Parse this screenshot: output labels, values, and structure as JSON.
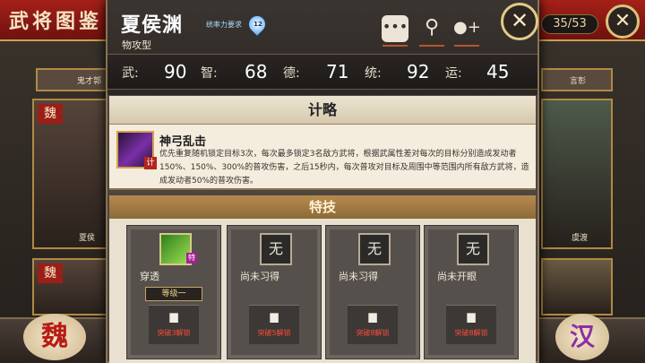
{
  "background": {
    "title": "武将图鉴",
    "count": "35/53",
    "left_card_name_top": "鬼才郭",
    "left_card_name": "夏侯",
    "left_faction": "魏",
    "right_card_name_top": "言彰",
    "right_card_name": "虞渡",
    "bottom_left_faction": "魏",
    "bottom_right_faction": "汉"
  },
  "general": {
    "name": "夏侯渊",
    "type": "物攻型",
    "badge": "统率力要求",
    "badge_level": "12",
    "stats": [
      {
        "key": "武:",
        "value": "90"
      },
      {
        "key": "智:",
        "value": "68"
      },
      {
        "key": "德:",
        "value": "71"
      },
      {
        "key": "统:",
        "value": "92"
      },
      {
        "key": "运:",
        "value": "45"
      }
    ]
  },
  "toolbar": {
    "chat_icon": "chat-bubble-icon",
    "search_icon": "magnifier-icon",
    "add_icon": "treasure-add-icon",
    "close_icon": "crossed-swords-close-icon"
  },
  "strategy": {
    "title": "计略",
    "name": "神弓乱击",
    "icon_tag": "计",
    "desc": "优先重复随机锁定目标3次，每次最多锁定3名敌方武将，根据武属性差对每次的目标分别造成发动者150%、150%、300%的普攻伤害，之后15秒内，每次普攻对目标及周围中等范围内所有敌方武将，造成发动者50%的普攻伤害。"
  },
  "specialties": {
    "title": "特技",
    "slots": [
      {
        "icon": "",
        "tag": "特",
        "label": "穿透",
        "level": "等级一",
        "lock": "▆",
        "unlock": "突破3解锁"
      },
      {
        "icon": "无",
        "tag": "",
        "label": "尚未习得",
        "level": "",
        "lock": "▆",
        "unlock": "突破5解锁"
      },
      {
        "icon": "无",
        "tag": "",
        "label": "尚未习得",
        "level": "",
        "lock": "▆",
        "unlock": "突破8解锁"
      },
      {
        "icon": "无",
        "tag": "",
        "label": "尚未开眼",
        "level": "",
        "lock": "▆",
        "unlock": "突破8解锁"
      }
    ]
  },
  "colors": {
    "accent_red": "#a52019",
    "gold": "#c9a24d",
    "unlock_red": "#ff4b3c"
  }
}
